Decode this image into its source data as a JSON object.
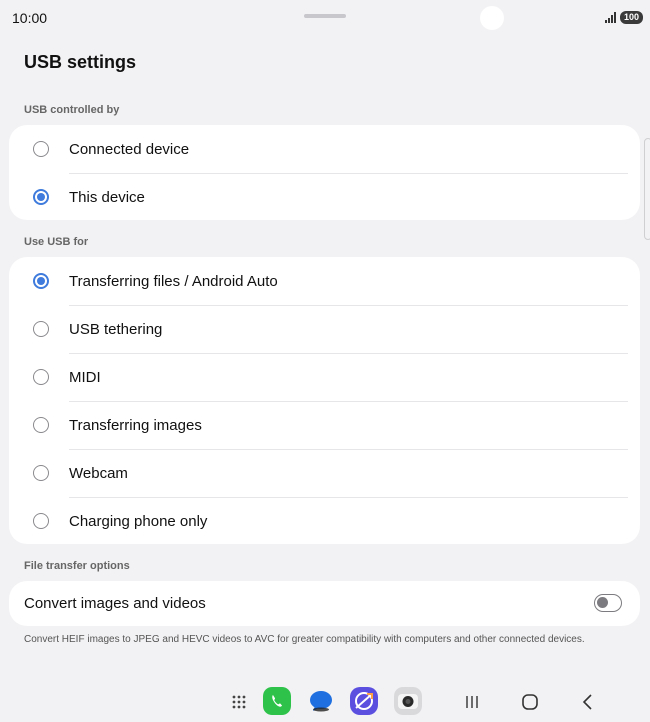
{
  "status_bar": {
    "time": "10:00",
    "battery": "100",
    "icons": [
      "signal-icon"
    ]
  },
  "page": {
    "title": "USB settings"
  },
  "usb_controlled_by": {
    "header": "USB controlled by",
    "options": [
      {
        "label": "Connected device",
        "selected": false
      },
      {
        "label": "This device",
        "selected": true
      }
    ]
  },
  "use_usb_for": {
    "header": "Use USB for",
    "options": [
      {
        "label": "Transferring files / Android Auto",
        "selected": true
      },
      {
        "label": "USB tethering",
        "selected": false
      },
      {
        "label": "MIDI",
        "selected": false
      },
      {
        "label": "Transferring images",
        "selected": false
      },
      {
        "label": "Webcam",
        "selected": false
      },
      {
        "label": "Charging phone only",
        "selected": false
      }
    ]
  },
  "file_transfer_options": {
    "header": "File transfer options",
    "convert_label": "Convert images and videos",
    "convert_enabled": false,
    "footnote": "Convert HEIF images to JPEG and HEVC videos to AVC for greater compatibility with computers and other connected devices."
  },
  "taskbar": {
    "apps": [
      "apps-grid-icon",
      "phone-app-icon",
      "messages-app-icon",
      "internet-app-icon",
      "camera-app-icon"
    ],
    "nav": [
      "recents-icon",
      "home-icon",
      "back-icon"
    ]
  },
  "colors": {
    "accent": "#3e7bdc",
    "background": "#f2f2f4",
    "card": "#ffffff",
    "phone_green": "#2fc24a",
    "messages_blue": "#1f6fe0",
    "internet_purple": "#5b4fe0"
  }
}
